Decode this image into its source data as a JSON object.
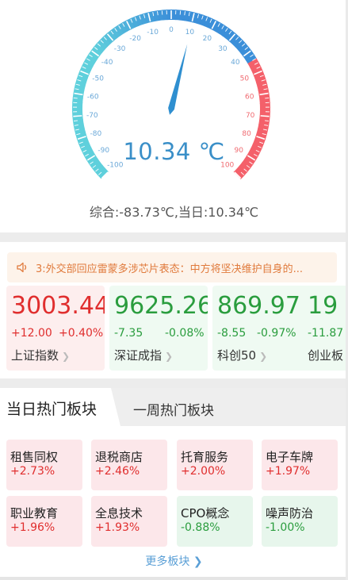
{
  "gauge": {
    "value": 10.34,
    "min": -100,
    "max": 100,
    "tick_labels": [
      "-100",
      "-90",
      "-80",
      "-70",
      "-60",
      "-50",
      "-40",
      "-30",
      "-20",
      "-10",
      "0",
      "10",
      "20",
      "30",
      "40",
      "50",
      "60",
      "70",
      "80",
      "90",
      "100"
    ],
    "readout": "10.34 ℃",
    "summary": "综合:-83.73℃,当日:10.34℃",
    "colors": {
      "cold": "#5fd0dc",
      "mid": "#3b8fd9",
      "hot": "#f4606a",
      "needle": "#2f8fd0",
      "label": "#6aa8d8",
      "hot_label": "#f06a70"
    }
  },
  "news": {
    "icon": "speaker-icon",
    "text": "3:外交部回应雷蒙多涉芯片表态：中方将坚决维护自身的..."
  },
  "indices": [
    {
      "value": "3003.44",
      "change": "+12.00",
      "pct": "+0.40%",
      "name": "上证指数",
      "trend": "up"
    },
    {
      "value": "9625.26",
      "change": "-7.35",
      "pct": "-0.08%",
      "name": "深证成指",
      "trend": "down"
    },
    {
      "value": "869.97",
      "change": "-8.55",
      "pct": "-0.97%",
      "name": "科创50",
      "trend": "down"
    },
    {
      "value": "19",
      "change": "-11.87",
      "pct": "",
      "name": "创业板",
      "trend": "down"
    }
  ],
  "tabs": {
    "active": "当日热门板块",
    "other": "一周热门板块"
  },
  "sectors": [
    {
      "name": "租售同权",
      "pct": "+2.73%",
      "trend": "up"
    },
    {
      "name": "退税商店",
      "pct": "+2.46%",
      "trend": "up"
    },
    {
      "name": "托育服务",
      "pct": "+2.00%",
      "trend": "up"
    },
    {
      "name": "电子车牌",
      "pct": "+1.97%",
      "trend": "up"
    },
    {
      "name": "职业教育",
      "pct": "+1.96%",
      "trend": "up"
    },
    {
      "name": "全息技术",
      "pct": "+1.93%",
      "trend": "up"
    },
    {
      "name": "CPO概念",
      "pct": "-0.88%",
      "trend": "down"
    },
    {
      "name": "噪声防治",
      "pct": "-1.00%",
      "trend": "down"
    }
  ],
  "more_link": "更多板块"
}
